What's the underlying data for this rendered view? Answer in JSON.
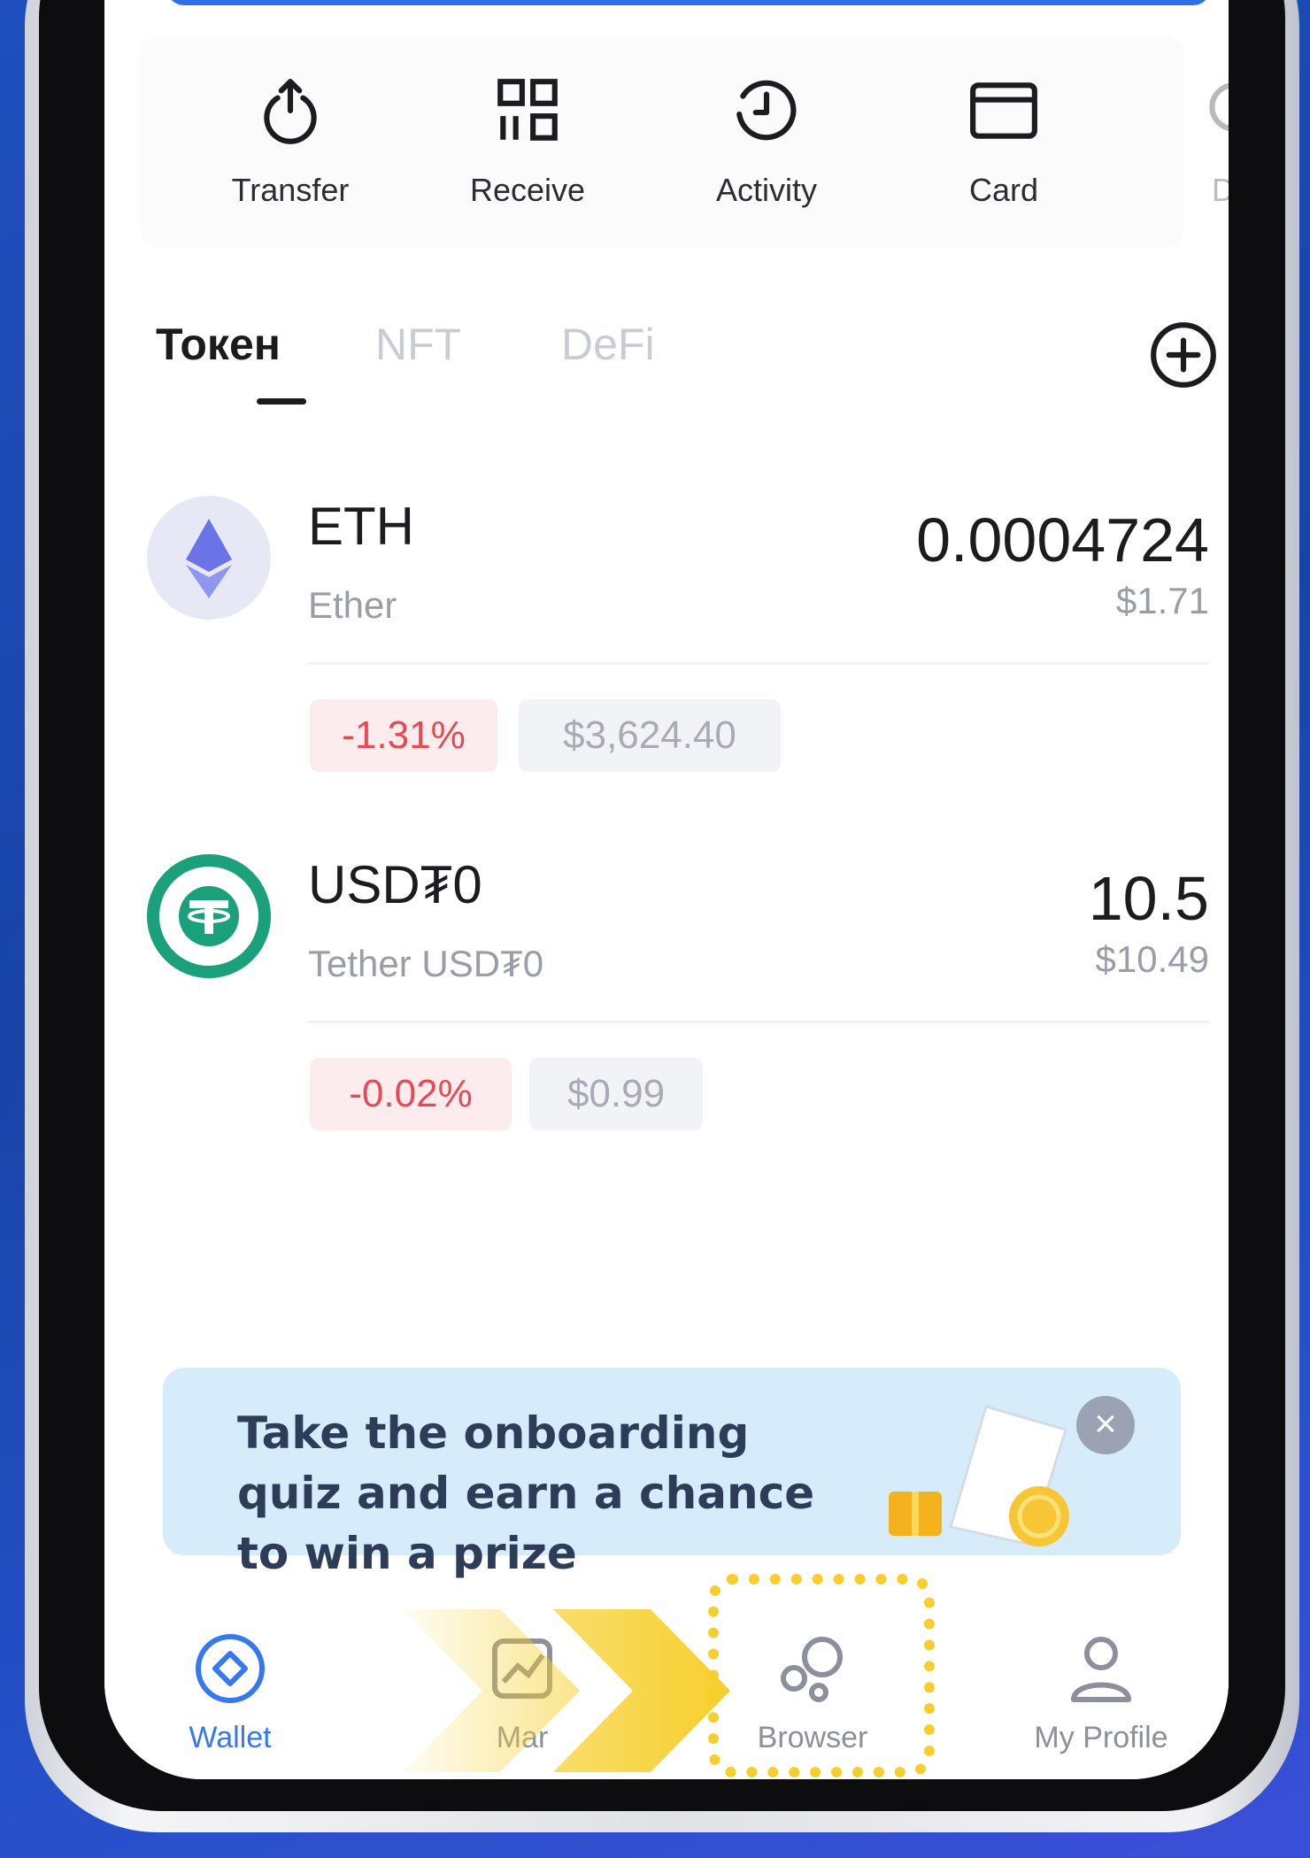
{
  "actions": [
    {
      "label": "Transfer",
      "icon": "transfer-icon"
    },
    {
      "label": "Receive",
      "icon": "receive-icon"
    },
    {
      "label": "Activity",
      "icon": "activity-icon"
    },
    {
      "label": "Card",
      "icon": "card-icon"
    },
    {
      "label": "DA",
      "icon": "dapp-icon"
    }
  ],
  "tabs": [
    "Токен",
    "NFT",
    "DeFi"
  ],
  "tokens": [
    {
      "symbol": "ETH",
      "name": "Ether",
      "amount": "0.0004724",
      "value": "$1.71",
      "change": "-1.31%",
      "price": "$3,624.40"
    },
    {
      "symbol": "USD₮0",
      "name": "Tether USD₮0",
      "amount": "10.5",
      "value": "$10.49",
      "change": "-0.02%",
      "price": "$0.99"
    }
  ],
  "banner": {
    "text": "Take the onboarding quiz and earn a chance to win a prize",
    "close": "×"
  },
  "nav": [
    {
      "label": "Wallet",
      "active": true
    },
    {
      "label": "Mar",
      "active": false
    },
    {
      "label": "Browser",
      "active": false
    },
    {
      "label": "My Profile",
      "active": false
    }
  ],
  "colors": {
    "accent": "#3578f0",
    "negative": "#e64a55",
    "highlight": "#f7cf2c",
    "tether": "#1aa07a",
    "eth": "#6a74e8"
  }
}
